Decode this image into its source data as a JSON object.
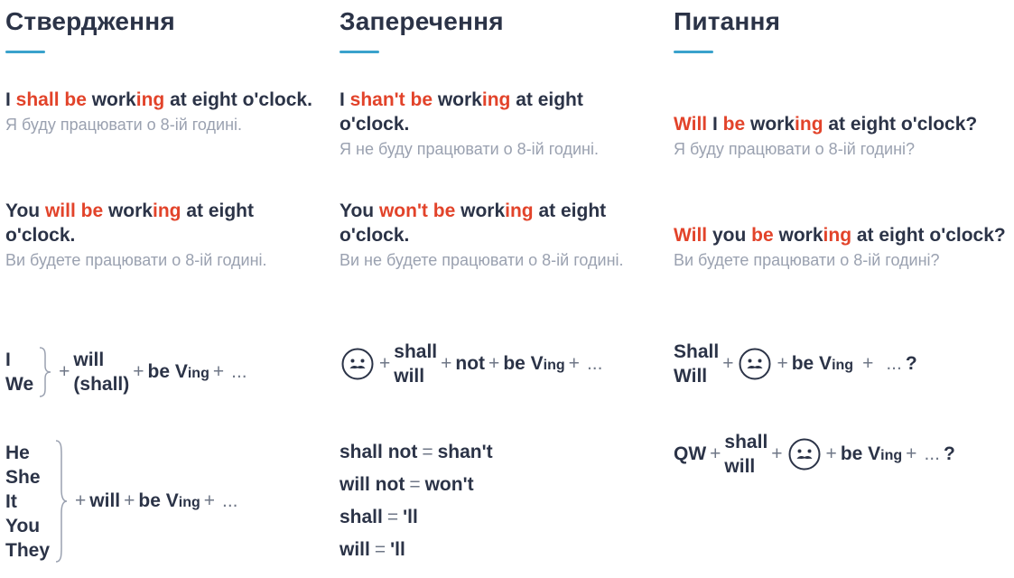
{
  "columns": [
    {
      "heading": "Ствердження"
    },
    {
      "heading": "Заперечення"
    },
    {
      "heading": "Питання"
    }
  ],
  "affirmative": {
    "ex1": {
      "p1": "I ",
      "p2": "shall be",
      "p3": " work",
      "p4": "ing",
      "p5": " at eight o'clock.",
      "uk": "Я буду працювати о 8-ій годині."
    },
    "ex2": {
      "p1": "You ",
      "p2": "will be",
      "p3": " work",
      "p4": "ing",
      "p5": " at eight o'clock.",
      "uk": "Ви будете працювати о 8-ій годині."
    },
    "formula1": {
      "subjects": [
        "I",
        "We"
      ],
      "plus1": "+",
      "aux1": "will",
      "aux2": "(shall)",
      "plus2": "+",
      "be": "be V",
      "ing": "ing",
      "plus3": "+",
      "tail": "..."
    },
    "formula2": {
      "subjects": [
        "He",
        "She",
        "It",
        "You",
        "They"
      ],
      "plus1": "+",
      "aux": "will",
      "plus2": "+",
      "be": "be V",
      "ing": "ing",
      "plus3": "+",
      "tail": "..."
    }
  },
  "negative": {
    "ex1": {
      "p1": "I ",
      "p2": "shan't be",
      "p3": " work",
      "p4": "ing",
      "p5": " at eight o'clock.",
      "uk": "Я не буду працювати о 8-ій годині."
    },
    "ex2": {
      "p1": "You ",
      "p2": "won't be",
      "p3": " work",
      "p4": "ing",
      "p5": " at eight o'clock.",
      "uk": "Ви не будете працювати о 8-ій годині."
    },
    "formula": {
      "plus1": "+",
      "aux1": "shall",
      "aux2": "will",
      "plus2": "+",
      "not": "not",
      "plus3": "+",
      "be": "be V",
      "ing": "ing",
      "plus4": "+",
      "tail": "..."
    },
    "contractions": [
      {
        "full": "shall not",
        "eq": "=",
        "short": "shan't"
      },
      {
        "full": "will not",
        "eq": "=",
        "short": "won't"
      },
      {
        "full": "shall",
        "eq": "=",
        "short": "'ll"
      },
      {
        "full": "will",
        "eq": "=",
        "short": "'ll"
      }
    ]
  },
  "question": {
    "ex1": {
      "p1": "Will",
      "p2": " I ",
      "p3": "be",
      "p4": " work",
      "p5": "ing",
      "p6": " at eight o'clock?",
      "uk": "Я буду працювати о 8-ій годині?"
    },
    "ex2": {
      "p1": "Will",
      "p2": " you ",
      "p3": "be",
      "p4": " work",
      "p5": "ing",
      "p6": " at eight o'clock?",
      "uk": "Ви будете працювати о 8-ій годині?"
    },
    "formula1": {
      "aux1": "Shall",
      "aux2": "Will",
      "plus1": "+",
      "plus2": "+",
      "be": "be V",
      "ing": "ing",
      "plus3": "+",
      "tail": "...",
      "qmark": "?"
    },
    "formula2": {
      "qw": "QW",
      "plus1": "+",
      "aux1": "shall",
      "aux2": "will",
      "plus2": "+",
      "plus3": "+",
      "be": "be V",
      "ing": "ing",
      "plus4": "+",
      "tail": "...",
      "qmark": "?"
    }
  },
  "icons": {
    "subject": "mustache-face-icon"
  },
  "colors": {
    "accent": "#e2432a",
    "text": "#2b3347",
    "muted": "#9aa1b0",
    "underline": "#3aa2cc"
  }
}
